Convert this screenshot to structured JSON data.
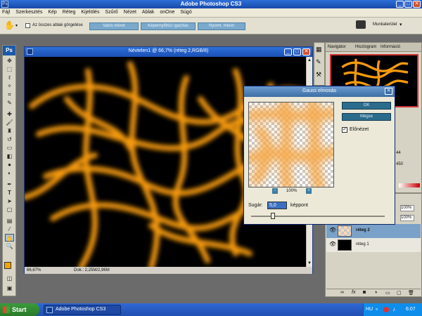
{
  "window": {
    "title": "Adobe Photoshop CS3"
  },
  "menu": [
    "Fájl",
    "Szerkesztés",
    "Kép",
    "Réteg",
    "Kijelölés",
    "Szűrő",
    "Nézet",
    "Ablak",
    "onOne",
    "Súgó"
  ],
  "options": {
    "scroll_all_label": "Az összes ablak görgetése",
    "btn1": "Valós méret",
    "btn2": "Képernyőhöz igazítás",
    "btn3": "Nyomt. méret",
    "workspace_label": "Munkaterület"
  },
  "ps_logo": "Ps",
  "document": {
    "title": "Névtelen1 @ 66,7% (réteg 2,RGB/8)",
    "zoom": "66,67%",
    "doc_info": "Dok.: 2,25M/2,96M"
  },
  "navigator": {
    "tabs": [
      "Navigátor",
      "Hisztogram",
      "Információ"
    ]
  },
  "info_values": [
    "44",
    "450"
  ],
  "layers": {
    "opacity": "100%",
    "fill": "100%",
    "rows": [
      {
        "name": "réteg 2"
      },
      {
        "name": "réteg 1"
      }
    ]
  },
  "dialog": {
    "title": "Gauss elmosás",
    "ok_label": "OK",
    "cancel_label": "Mégse",
    "preview_label": "Előnézet",
    "preview_checked": true,
    "zoom": "100%",
    "radius_label": "Sugár:",
    "radius_value": "5,0",
    "radius_unit": "képpont"
  },
  "taskbar": {
    "start_label": "Start",
    "task_label": "Adobe Photoshop CS3",
    "language": "HU",
    "time": "6:07"
  },
  "colors": {
    "foreground": "#f5a300",
    "background": "#000000",
    "accent": "#f59a0e"
  }
}
